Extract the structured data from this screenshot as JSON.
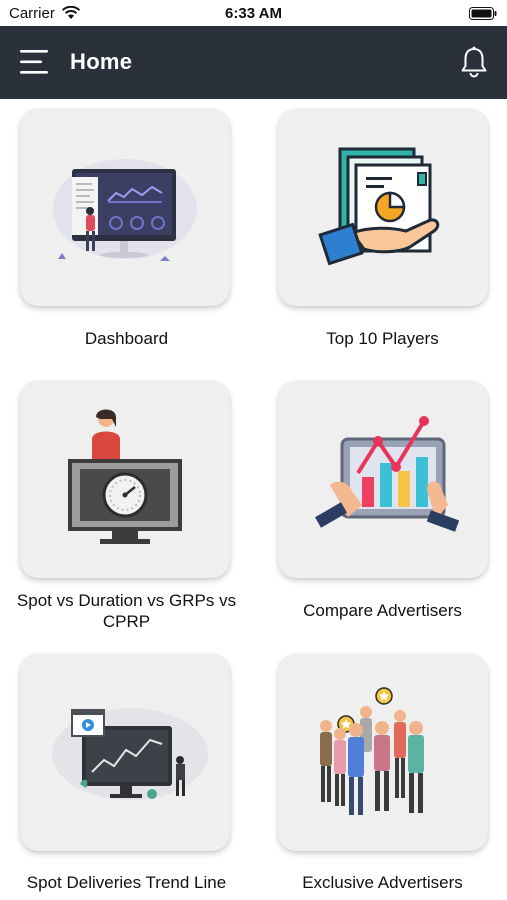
{
  "status_bar": {
    "carrier": "Carrier",
    "time": "6:33 AM"
  },
  "header": {
    "title": "Home",
    "menu_icon": "hamburger-menu-icon",
    "notification_icon": "bell-icon",
    "background": "#2b313a"
  },
  "tiles": [
    {
      "label": "Dashboard",
      "illustration": "dashboard-illustration"
    },
    {
      "label": "Top 10 Players",
      "illustration": "top-players-illustration"
    },
    {
      "label": "Spot vs Duration vs GRPs vs CPRP",
      "illustration": "gauge-monitor-illustration"
    },
    {
      "label": "Compare Advertisers",
      "illustration": "compare-chart-illustration"
    },
    {
      "label": "Spot Deliveries Trend Line",
      "illustration": "trend-line-illustration"
    },
    {
      "label": "Exclusive Advertisers",
      "illustration": "exclusive-group-illustration"
    }
  ]
}
